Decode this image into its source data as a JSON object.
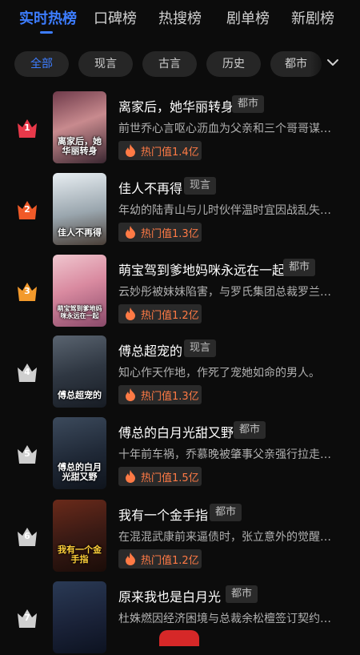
{
  "tabs": [
    "实时热榜",
    "口碑榜",
    "热搜榜",
    "剧单榜",
    "新剧榜"
  ],
  "active_tab": 0,
  "filters": [
    "全部",
    "现言",
    "古言",
    "历史",
    "都市"
  ],
  "active_filter": 0,
  "rank_colors": [
    "#e8394a",
    "#f05a28",
    "#f39a2c",
    "#cfcfcf"
  ],
  "heat_color": "#ff7a45",
  "accent": "#3d7dff",
  "items": [
    {
      "rank": "1",
      "title": "离家后，她华丽转身",
      "genre": "都市",
      "desc": "前世乔心言呕心沥血为父亲和三个哥哥谋…",
      "heat": "热门值1.4亿",
      "poster_text": "离家后，她华丽转身"
    },
    {
      "rank": "2",
      "title": "佳人不再得",
      "genre": "现言",
      "desc": "年幼的陆青山与儿时伙伴温时宜因战乱失…",
      "heat": "热门值1.3亿",
      "poster_text": "佳人不再得"
    },
    {
      "rank": "3",
      "title": "萌宝驾到爹地妈咪永远在一起",
      "genre": "都市",
      "desc": "云妙彤被妹妹陷害，与罗氏集团总裁罗兰…",
      "heat": "热门值1.2亿",
      "poster_text": "萌宝驾到爹地妈咪永远在一起"
    },
    {
      "rank": "4",
      "title": "傅总超宠的",
      "genre": "现言",
      "desc": "知心作天作地，作死了宠她如命的男人。",
      "heat": "热门值1.3亿",
      "poster_text": "傅总超宠的"
    },
    {
      "rank": "5",
      "title": "傅总的白月光甜又野",
      "genre": "都市",
      "desc": "十年前车祸，乔慕晚被肇事父亲强行拉走…",
      "heat": "热门值1.5亿",
      "poster_text": "傅总的白月光甜又野"
    },
    {
      "rank": "6",
      "title": "我有一个金手指",
      "genre": "都市",
      "desc": "在混混武康前来逼债时，张立意外的觉醒…",
      "heat": "热门值1.2亿",
      "poster_text": "我有一个金手指"
    },
    {
      "rank": "7",
      "title": "原来我也是白月光",
      "genre": "都市",
      "desc": "杜姝燃因经济困境与总裁余松檀签订契约…",
      "heat": "",
      "poster_text": ""
    }
  ]
}
